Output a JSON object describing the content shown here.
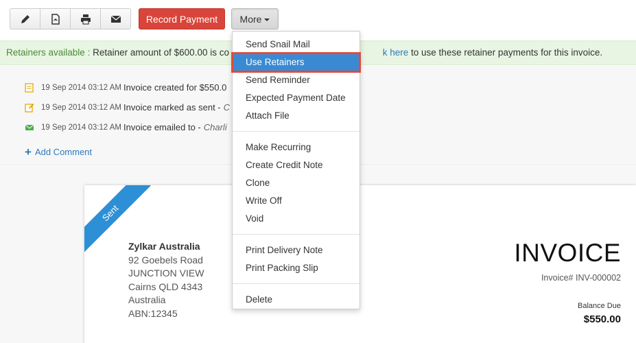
{
  "toolbar": {
    "icons": [
      "edit-icon",
      "pdf-icon",
      "print-icon",
      "email-icon"
    ],
    "record_payment_label": "Record Payment",
    "more_label": "More"
  },
  "retainer_bar": {
    "label": "Retainers available :",
    "text_before": "Retainer amount of $600.00 is co",
    "link_fragment": "k here",
    "text_after": "to use these retainer payments for this invoice."
  },
  "activity": {
    "items": [
      {
        "icon": "note-icon",
        "time": "19 Sep 2014 03:12 AM",
        "text": "Invoice created for $550.0",
        "italic": ""
      },
      {
        "icon": "edit-note-icon",
        "time": "19 Sep 2014 03:12 AM",
        "text": "Invoice marked as sent -",
        "italic": "C"
      },
      {
        "icon": "mail-icon",
        "time": "19 Sep 2014 03:12 AM",
        "text": "Invoice emailed to -",
        "italic": "Charli"
      }
    ],
    "add_comment": "Add Comment"
  },
  "invoice": {
    "status_ribbon": "Sent",
    "org_name": "Zylkar Australia",
    "address": [
      "92 Goebels Road",
      "JUNCTION VIEW",
      "Cairns QLD 4343",
      "Australia",
      "ABN:12345"
    ],
    "title": "INVOICE",
    "number": "Invoice# INV-000002",
    "balance_label": "Balance Due",
    "balance_amount": "$550.00"
  },
  "more_menu": {
    "group1": [
      "Send Snail Mail",
      "Use Retainers",
      "Send Reminder",
      "Expected Payment Date",
      "Attach File"
    ],
    "group2": [
      "Make Recurring",
      "Create Credit Note",
      "Clone",
      "Write Off",
      "Void"
    ],
    "group3": [
      "Print Delivery Note",
      "Print Packing Slip"
    ],
    "group4": [
      "Delete"
    ],
    "highlighted": "Use Retainers"
  },
  "colors": {
    "record_button": "#d9453a",
    "link": "#2b7bc0",
    "ribbon": "#2d8fd6",
    "menu_highlight": "#3a8ad3",
    "highlight_outline": "#e24a3b",
    "retainer_label": "#4a8a37"
  }
}
